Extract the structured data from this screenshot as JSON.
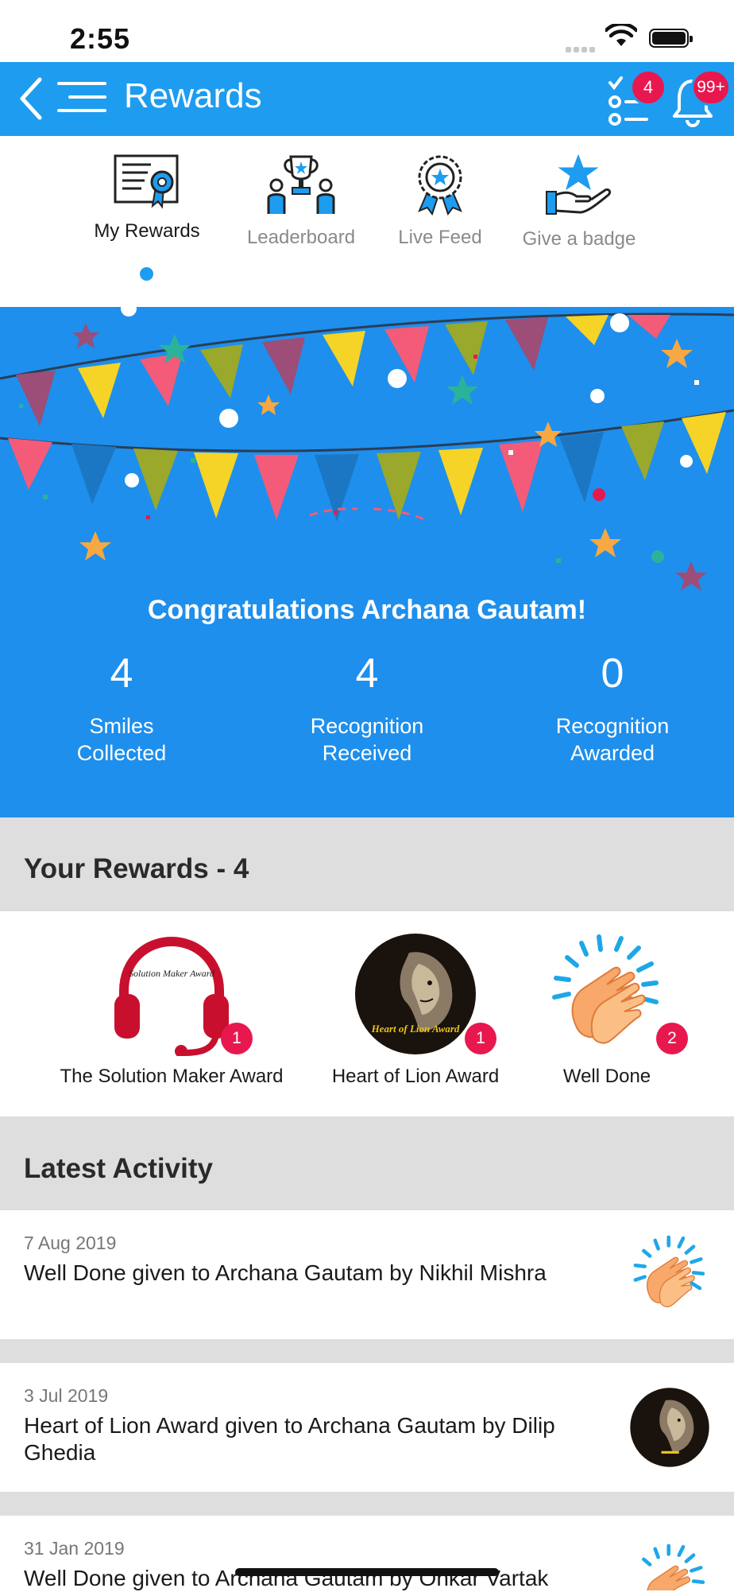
{
  "status_bar": {
    "time": "2:55"
  },
  "header": {
    "title": "Rewards",
    "tasks_badge": "4",
    "notifications_badge": "99+",
    "icons": [
      "back-icon",
      "menu-icon",
      "tasks-icon",
      "bell-icon"
    ]
  },
  "tabs": [
    {
      "label": "My Rewards",
      "active": true,
      "icon": "certificate-icon"
    },
    {
      "label": "Leaderboard",
      "active": false,
      "icon": "trophy-icon"
    },
    {
      "label": "Live Feed",
      "active": false,
      "icon": "medal-icon"
    },
    {
      "label": "Give a badge",
      "active": false,
      "icon": "hand-star-icon"
    }
  ],
  "banner": {
    "greeting": "Congratulations Archana Gautam!",
    "stats": [
      {
        "value": "4",
        "label": "Smiles\nCollected"
      },
      {
        "value": "4",
        "label": "Recognition\nReceived"
      },
      {
        "value": "0",
        "label": "Recognition\nAwarded"
      }
    ]
  },
  "rewards_section": {
    "heading": "Your Rewards - 4",
    "items": [
      {
        "name": "The Solution Maker Award",
        "count": "1",
        "badge_text": "Solution Maker Award"
      },
      {
        "name": "Heart of Lion Award",
        "count": "1",
        "badge_text": "Heart of Lion Award"
      },
      {
        "name": "Well Done",
        "count": "2"
      }
    ]
  },
  "activity_section": {
    "heading": "Latest Activity",
    "items": [
      {
        "date": "7 Aug 2019",
        "text": "Well Done given to Archana Gautam by Nikhil Mishra"
      },
      {
        "date": "3 Jul 2019",
        "text": "Heart of Lion Award given to Archana Gautam by Dilip Ghedia"
      },
      {
        "date": "31 Jan 2019",
        "text": "Well Done given to Archana Gautam by Onkar Vartak"
      }
    ]
  },
  "colors": {
    "primary": "#1e9cf0",
    "banner": "#1e8fec",
    "badge": "#e8184f",
    "section_bg": "#dedede"
  }
}
